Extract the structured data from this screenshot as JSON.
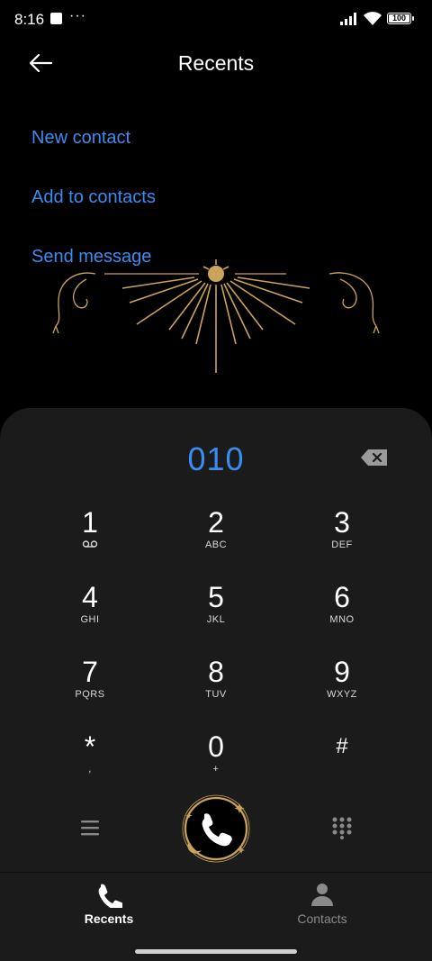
{
  "status_bar": {
    "time": "8:16",
    "more": "···",
    "battery": "100"
  },
  "header": {
    "title": "Recents"
  },
  "options": {
    "new_contact": "New contact",
    "add_to_contacts": "Add to contacts",
    "send_message": "Send message"
  },
  "dialer": {
    "number": "010",
    "keys": [
      {
        "digit": "1",
        "letters": ""
      },
      {
        "digit": "2",
        "letters": "ABC"
      },
      {
        "digit": "3",
        "letters": "DEF"
      },
      {
        "digit": "4",
        "letters": "GHI"
      },
      {
        "digit": "5",
        "letters": "JKL"
      },
      {
        "digit": "6",
        "letters": "MNO"
      },
      {
        "digit": "7",
        "letters": "PQRS"
      },
      {
        "digit": "8",
        "letters": "TUV"
      },
      {
        "digit": "9",
        "letters": "WXYZ"
      },
      {
        "digit": "*",
        "letters": ","
      },
      {
        "digit": "0",
        "letters": "+"
      },
      {
        "digit": "#",
        "letters": ""
      }
    ]
  },
  "tabs": [
    {
      "label": "Recents",
      "icon": "phone-icon",
      "active": true
    },
    {
      "label": "Contacts",
      "icon": "person-icon",
      "active": false
    }
  ],
  "colors": {
    "accent": "#3b8cf0",
    "gold": "#c9a45a",
    "panel": "#1b1b1b"
  }
}
